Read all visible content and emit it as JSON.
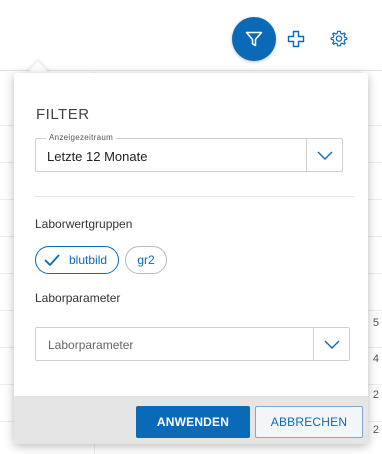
{
  "filter_panel": {
    "title": "FILTER",
    "period": {
      "label": "Anzeigezeitraum",
      "value": "Letzte 12 Monate"
    },
    "groups": {
      "label": "Laborwertgruppen",
      "chips": [
        {
          "label": "blutbild",
          "selected": true
        },
        {
          "label": "gr2",
          "selected": false
        }
      ]
    },
    "parameters": {
      "label": "Laborparameter",
      "placeholder": "Laborparameter"
    },
    "buttons": {
      "apply": "ANWENDEN",
      "cancel": "ABBRECHEN"
    }
  },
  "background": {
    "edge_digits": [
      "5",
      "4",
      "2",
      "2"
    ]
  },
  "icons": {
    "filter": "filter-icon",
    "add": "plus-icon",
    "settings": "gear-icon"
  },
  "colors": {
    "accent": "#0a6ab8",
    "footer_bg": "#e5e5e5"
  }
}
